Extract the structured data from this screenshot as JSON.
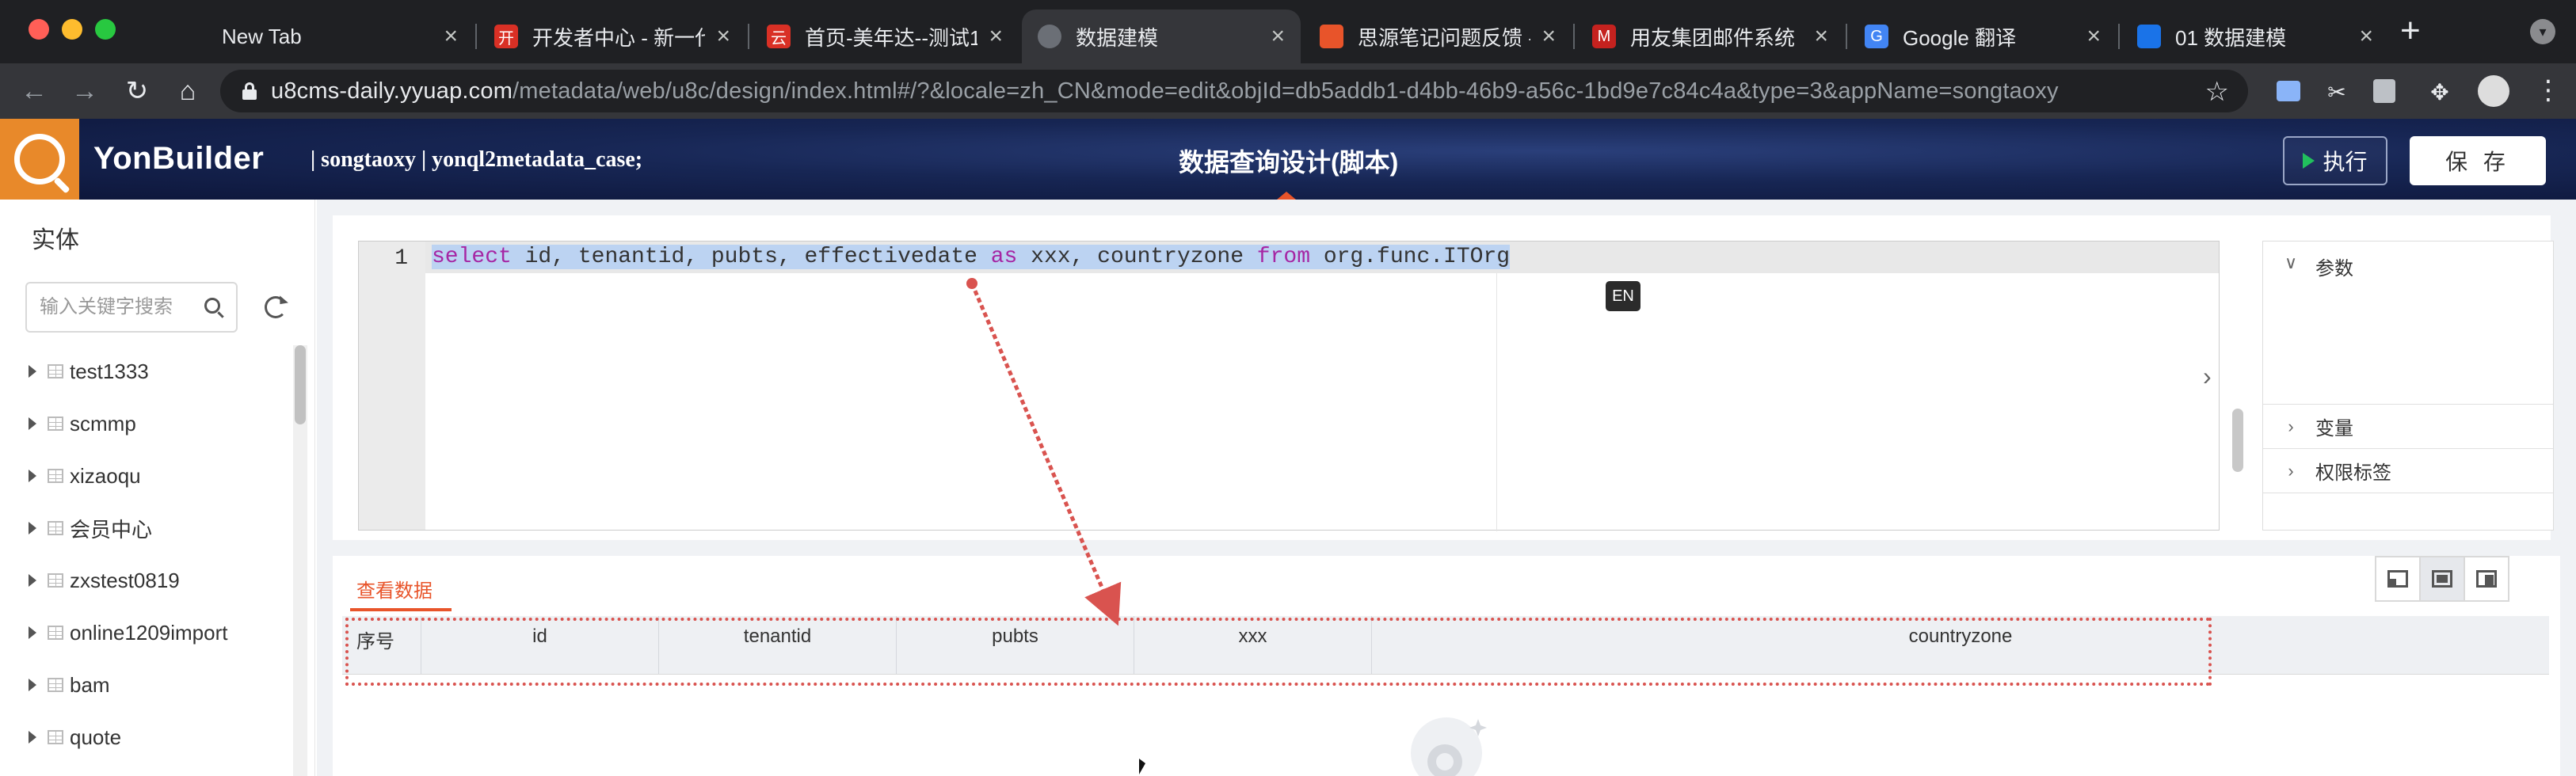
{
  "browser": {
    "tabs": [
      {
        "title": "New Tab",
        "favicon": "blank-icon",
        "favicon_color": ""
      },
      {
        "title": "开发者中心 - 新一代",
        "favicon": "kai-logo-icon",
        "favicon_color": "#d93025"
      },
      {
        "title": "首页-美年达--测试1",
        "favicon": "yun-logo-icon",
        "favicon_color": "#d93025"
      },
      {
        "title": "数据建模",
        "favicon": "globe-icon",
        "favicon_color": "#6b6f76"
      },
      {
        "title": "思源笔记问题反馈 -",
        "favicon": "siyuan-icon",
        "favicon_color": "#e8542a"
      },
      {
        "title": "用友集团邮件系统",
        "favicon": "yonyou-mail-icon",
        "favicon_color": "#c5221f"
      },
      {
        "title": "Google 翻译",
        "favicon": "google-translate-icon",
        "favicon_color": "#4285f4"
      },
      {
        "title": "01 数据建模",
        "favicon": "doc-icon",
        "favicon_color": "#1a73e8"
      }
    ],
    "active_tab": 3,
    "url_host": "u8cms-daily.yyuap.com",
    "url_path": "/metadata/web/u8c/design/index.html#/?&locale=zh_CN&mode=edit&objId=db5addb1-d4bb-46b9-a56c-1bd9e7c84c4a&type=3&appName=songtaoxy"
  },
  "header": {
    "brand": "YonBuilder",
    "user_info": "| songtaoxy | yonql2metadata_case;",
    "title": "数据查询设计(脚本)",
    "run_label": "执行",
    "save_label": "保 存",
    "accent_color": "#e8542a"
  },
  "sidebar": {
    "title": "实体",
    "search_placeholder": "输入关键字搜索",
    "items": [
      {
        "label": "test1333"
      },
      {
        "label": "scmmp"
      },
      {
        "label": "xizaoqu"
      },
      {
        "label": "会员中心"
      },
      {
        "label": "zxstest0819"
      },
      {
        "label": "online1209import"
      },
      {
        "label": "bam"
      },
      {
        "label": "quote"
      }
    ]
  },
  "editor": {
    "line_number": "1",
    "code": {
      "kw_select": "select",
      "part1": " id, tenantid, pubts, effectivedate ",
      "kw_as": "as",
      "part2": " xxx, countryzone ",
      "kw_from": "from",
      "part3": " org.func.ITOrg"
    },
    "ime_badge": "EN"
  },
  "params": {
    "sections": [
      {
        "label": "参数",
        "expanded": true
      },
      {
        "label": "变量",
        "expanded": false
      },
      {
        "label": "权限标签",
        "expanded": false
      }
    ]
  },
  "data_view": {
    "tab_label": "查看数据",
    "columns": [
      "序号",
      "id",
      "tenantid",
      "pubts",
      "xxx",
      "countryzone"
    ]
  }
}
